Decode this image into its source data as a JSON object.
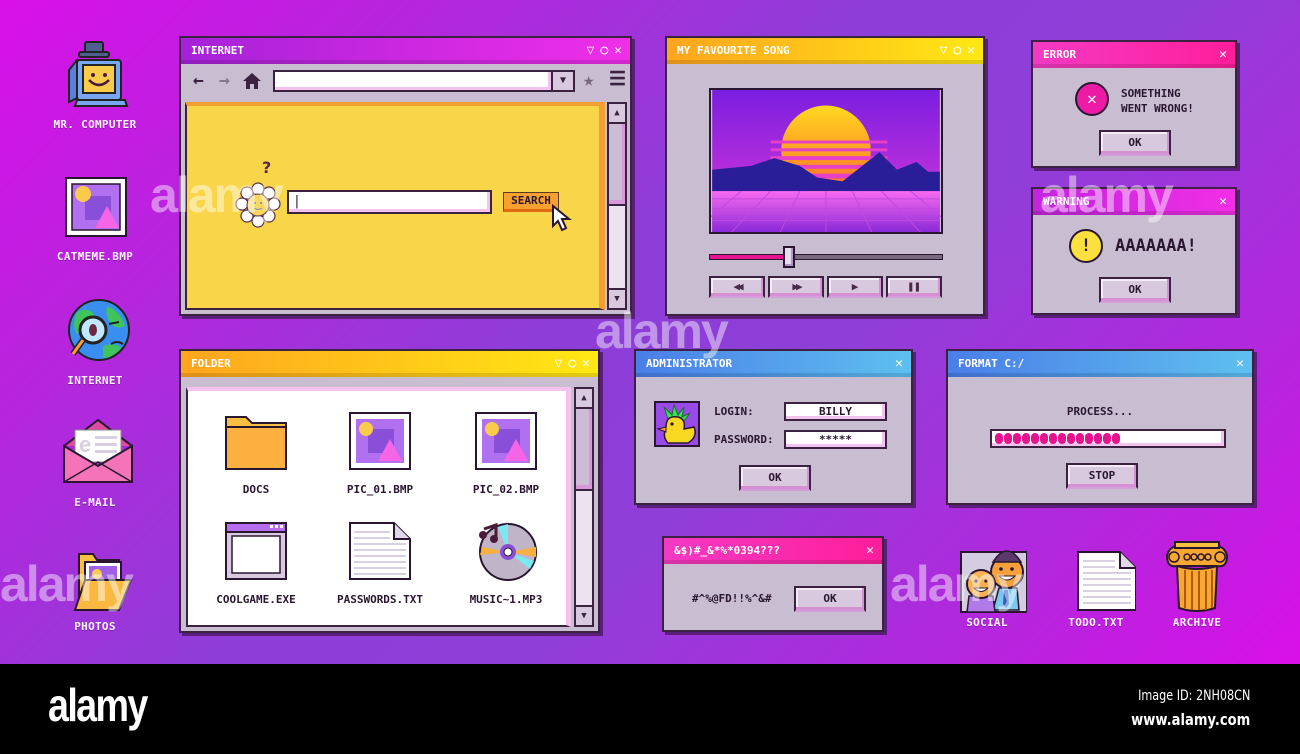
{
  "desktop_icons": [
    {
      "label": "MR. COMPUTER",
      "icon": "computer-icon"
    },
    {
      "label": "CATMEME.BMP",
      "icon": "image-icon"
    },
    {
      "label": "INTERNET",
      "icon": "globe-icon"
    },
    {
      "label": "E-MAIL",
      "icon": "envelope-icon"
    },
    {
      "label": "PHOTOS",
      "icon": "photo-folder-icon"
    },
    {
      "label": "SOCIAL",
      "icon": "people-icon"
    },
    {
      "label": "TODO.TXT",
      "icon": "text-file-icon"
    },
    {
      "label": "ARCHIVE",
      "icon": "column-icon"
    }
  ],
  "window_controls": {
    "minimize": "▽",
    "maximize": "○",
    "close": "✕"
  },
  "internet_window": {
    "title": "INTERNET",
    "nav": {
      "back": "←",
      "forward": "→",
      "home": "home-icon",
      "star": "★",
      "menu": "☰"
    },
    "address_value": "",
    "dropdown_arrow": "▼",
    "search_value": "",
    "search_label": "SEARCH",
    "mascot_hint": "?"
  },
  "player_window": {
    "title": "MY FAVOURITE SONG",
    "progress_percent": 34,
    "controls": {
      "rewind": "◀◀",
      "forward": "▶▶",
      "play": "▶",
      "pause": "❚❚"
    }
  },
  "error_dialog": {
    "title": "ERROR",
    "message_line1": "SOMETHING",
    "message_line2": "WENT WRONG!",
    "ok_label": "OK"
  },
  "warning_dialog": {
    "title": "WARNING",
    "message": "AAAAAAA!",
    "ok_label": "OK"
  },
  "folder_window": {
    "title": "FOLDER",
    "items": [
      {
        "label": "DOCS",
        "icon": "folder-icon"
      },
      {
        "label": "PIC_01.BMP",
        "icon": "image-icon"
      },
      {
        "label": "PIC_02.BMP",
        "icon": "image-icon"
      },
      {
        "label": "COOLGAME.EXE",
        "icon": "program-window-icon"
      },
      {
        "label": "PASSWORDS.TXT",
        "icon": "text-file-icon"
      },
      {
        "label": "MUSIC~1.MP3",
        "icon": "music-disc-icon"
      }
    ]
  },
  "admin_dialog": {
    "title": "ADMINISTRATOR",
    "login_label": "LOGIN:",
    "login_value": "BILLY",
    "password_label": "PASSWORD:",
    "password_value": "*****",
    "ok_label": "OK"
  },
  "format_dialog": {
    "title": "FORMAT C:/",
    "status": "PROCESS...",
    "progress_percent": 53,
    "progress_segments_filled": 14,
    "stop_label": "STOP"
  },
  "glitch_dialog": {
    "title": "&$)#_&*%*0394???",
    "message": "#^%@FD!!%^&#",
    "ok_label": "OK"
  },
  "footer": {
    "logo": "alamy",
    "image_id": "Image ID: 2NH08CN",
    "url": "www.alamy.com"
  },
  "watermark": "alamy",
  "colors": {
    "bg_magenta": "#d80fe8",
    "bg_purple": "#8d3ed8",
    "window_body": "#c9bdd2",
    "progress_pink": "#e6138f",
    "browser_page": "#f9d54a"
  }
}
